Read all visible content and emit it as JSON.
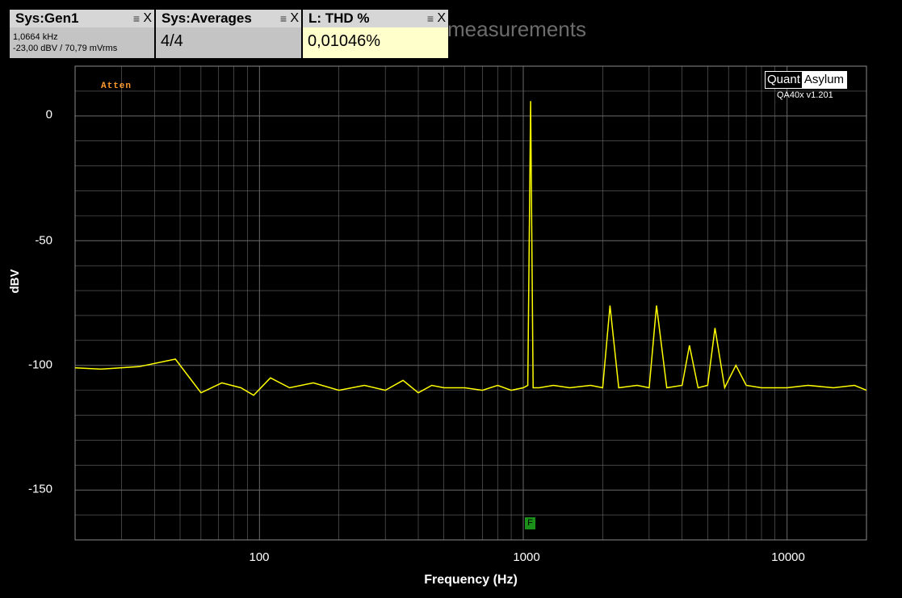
{
  "widgets": {
    "gen": {
      "title": "Sys:Gen1",
      "line1": "1,0664 kHz",
      "line2": "-23,00 dBV  / 70,79 mVrms",
      "menu_glyph": "≡",
      "close_glyph": "X"
    },
    "avg": {
      "title": "Sys:Averages",
      "value": "4/4",
      "menu_glyph": "≡",
      "close_glyph": "X"
    },
    "thd": {
      "title": "L: THD %",
      "value": "0,01046%",
      "menu_glyph": "≡",
      "close_glyph": "X"
    }
  },
  "background_title": "measurements",
  "atten_label": "Atten",
  "logo": {
    "quant": "Quant",
    "asylum": "Asylum",
    "version": "QA40x v1.201"
  },
  "marker_label": "F",
  "colors": {
    "trace": "#ffff00",
    "grid": "#6a6a6a",
    "plot_bg": "#000000",
    "widget_header": "#d6d6d6",
    "thd_value_bg": "#ffffcc"
  },
  "chart_data": {
    "type": "line",
    "xlabel": "Frequency (Hz)",
    "ylabel": "dBV",
    "x_scale": "log",
    "xlim": [
      20,
      20000
    ],
    "ylim": [
      -170,
      20
    ],
    "x_tick_labels": [
      "100",
      "1000",
      "10000"
    ],
    "y_tick_labels": [
      "0",
      "-50",
      "-100",
      "-150"
    ],
    "grid": true,
    "series": [
      {
        "x": [
          20,
          25,
          35,
          48,
          60,
          72,
          85,
          95,
          110,
          130,
          160,
          200,
          250,
          300,
          350,
          400,
          450,
          500,
          600,
          700,
          800,
          900,
          1000,
          1040,
          1066,
          1090,
          1150,
          1300,
          1500,
          1800,
          2000,
          2132,
          2300,
          2700,
          3000,
          3199,
          3500,
          4000,
          4265,
          4600,
          5000,
          5332,
          5800,
          6398,
          7000,
          8000,
          10000,
          12000,
          15000,
          18000,
          20000
        ],
        "y": [
          -101,
          -101.5,
          -100.5,
          -97.5,
          -111,
          -107,
          -109,
          -112,
          -105,
          -109,
          -107,
          -110,
          -108,
          -110,
          -106,
          -111,
          -108,
          -109,
          -109,
          -110,
          -108,
          -110,
          -109,
          -108,
          6,
          -109,
          -109,
          -108,
          -109,
          -108,
          -109,
          -76,
          -109,
          -108,
          -109,
          -76,
          -109,
          -108,
          -92,
          -109,
          -108,
          -85,
          -109,
          -100,
          -108,
          -109,
          -109,
          -108,
          -109,
          -108,
          -110
        ]
      }
    ]
  }
}
